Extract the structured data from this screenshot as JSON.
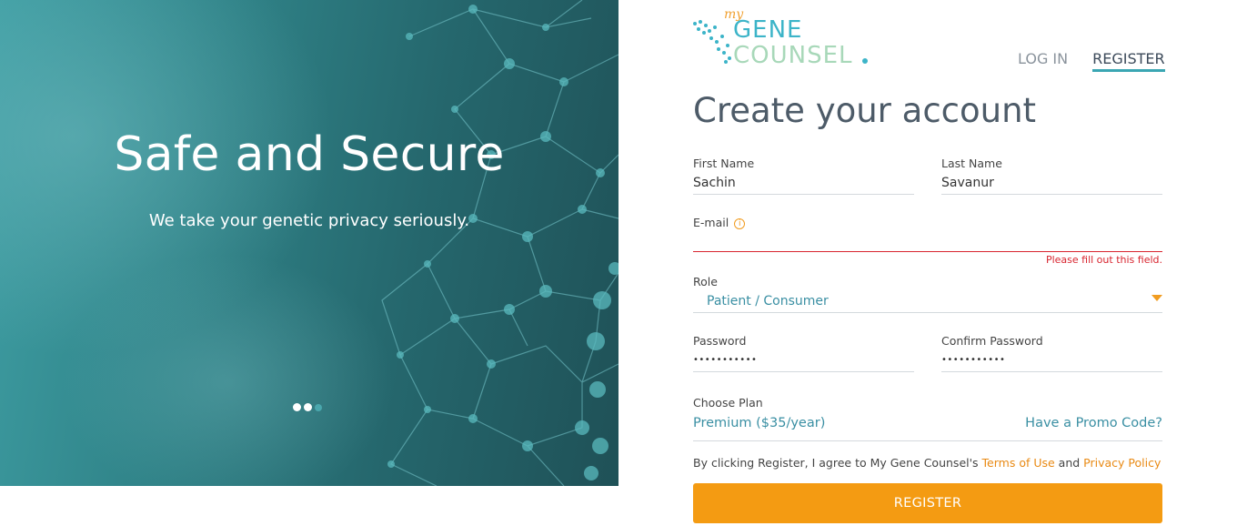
{
  "hero": {
    "title": "Safe and Secure",
    "subtitle": "We take your genetic privacy seriously.",
    "carousel": {
      "count": 3,
      "active_index": 1
    }
  },
  "brand": {
    "logo_my": "my",
    "logo_line1": "GENE",
    "logo_line2": "COUNSEL",
    "colors": {
      "teal": "#3aa6b3",
      "orange": "#f49b12",
      "error": "#d8252f"
    }
  },
  "nav": {
    "login": "LOG IN",
    "register": "REGISTER",
    "active": "register"
  },
  "form": {
    "title": "Create your account",
    "first_name": {
      "label": "First Name",
      "value": "Sachin"
    },
    "last_name": {
      "label": "Last Name",
      "value": "Savanur"
    },
    "email": {
      "label": "E-mail",
      "value": "",
      "icon": "info-icon",
      "error": "Please fill out this field."
    },
    "role": {
      "label": "Role",
      "value": "Patient / Consumer",
      "icon": "caret-down-icon"
    },
    "password": {
      "label": "Password",
      "value": "•••••••••••"
    },
    "confirm_password": {
      "label": "Confirm Password",
      "value": "•••••••••••"
    },
    "plan": {
      "label": "Choose Plan",
      "value": "Premium ($35/year)",
      "promo_link": "Have a Promo Code?"
    },
    "terms": {
      "prefix": "By clicking Register, I agree to My Gene Counsel's ",
      "terms_link": "Terms of Use",
      "middle": " and ",
      "privacy_link": "Privacy Policy"
    },
    "submit": "REGISTER"
  }
}
